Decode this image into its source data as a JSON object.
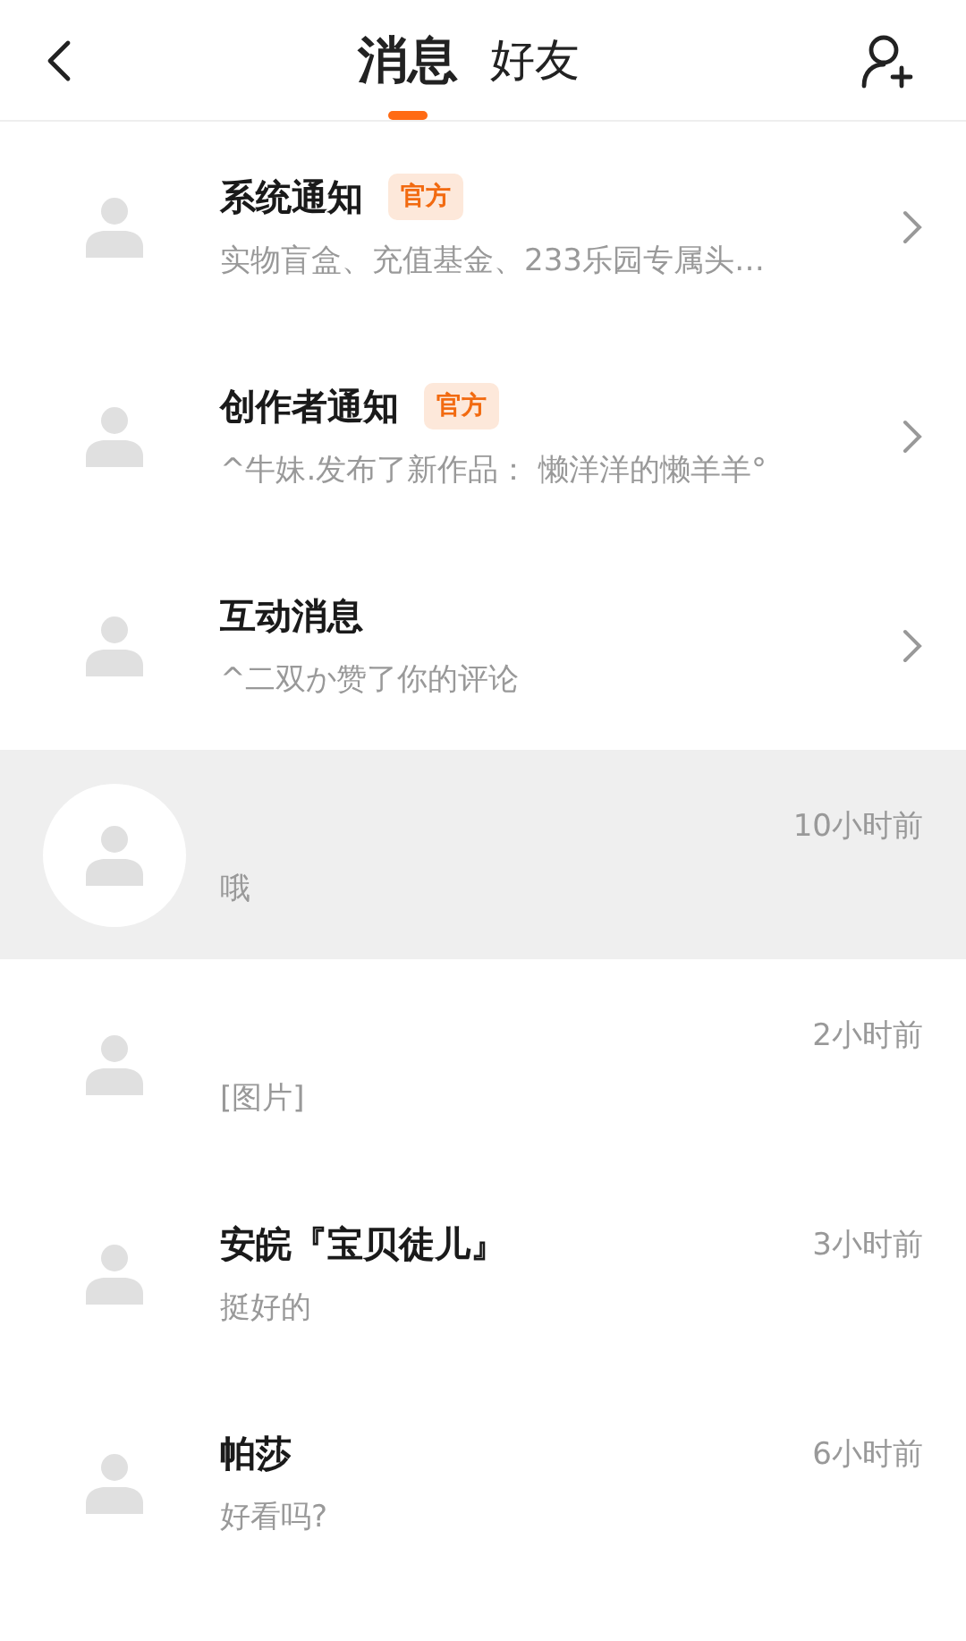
{
  "header": {
    "tabs": [
      {
        "label": "消息",
        "selected": true
      },
      {
        "label": "好友",
        "selected": false
      }
    ]
  },
  "conversations": [
    {
      "kind": "notice",
      "name": "系统通知",
      "badge": "官方",
      "preview": "实物盲盒、充值基金、233乐园专属头…",
      "selected": false
    },
    {
      "kind": "notice",
      "name": "创作者通知",
      "badge": "官方",
      "preview": "^牛妹.发布了新作品：   懒洋洋的懒羊羊°",
      "selected": false
    },
    {
      "kind": "notice",
      "name": "互动消息",
      "preview": "^二双か赞了你的评论",
      "selected": false
    },
    {
      "kind": "chat",
      "time": "10小时前",
      "preview": "哦",
      "selected": true
    },
    {
      "kind": "chat",
      "time": "2小时前",
      "preview": "[图片]",
      "selected": false
    },
    {
      "kind": "chat",
      "name": "安皖『宝贝徒儿』",
      "time": "3小时前",
      "preview": "挺好的",
      "selected": false
    },
    {
      "kind": "chat",
      "name": "帕莎",
      "time": "6小时前",
      "preview": "好看吗?",
      "selected": false
    }
  ]
}
